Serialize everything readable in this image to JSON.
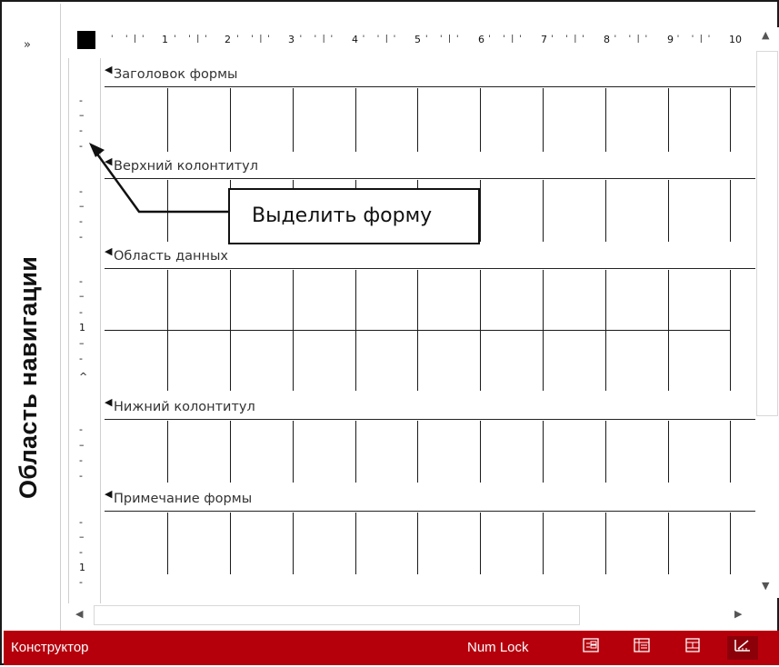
{
  "navigation_pane": {
    "title": "Область навигации",
    "toggle_icon": "double-chevron-right"
  },
  "ruler": {
    "top_numbers": [
      "1",
      "2",
      "3",
      "4",
      "5",
      "6",
      "7",
      "8",
      "9",
      "10"
    ],
    "left_marks": [
      "-",
      "–",
      "-",
      "-",
      "-",
      "–",
      "-",
      "-",
      "-",
      "–",
      "-",
      "1",
      "–",
      "-",
      "^",
      "-",
      "–",
      "-",
      "-",
      "-",
      "–",
      "-",
      "1",
      "-"
    ]
  },
  "sections": [
    {
      "label": "Заголовок формы"
    },
    {
      "label": "Верхний колонтитул"
    },
    {
      "label": "Область данных"
    },
    {
      "label": "Нижний колонтитул"
    },
    {
      "label": "Примечание формы"
    }
  ],
  "callout": {
    "text": "Выделить форму"
  },
  "status_bar": {
    "mode": "Конструктор",
    "num_lock": "Num Lock",
    "view_buttons": [
      "form-view-icon",
      "datasheet-view-icon",
      "layout-view-icon",
      "design-view-icon"
    ],
    "color": "#b5000c"
  }
}
